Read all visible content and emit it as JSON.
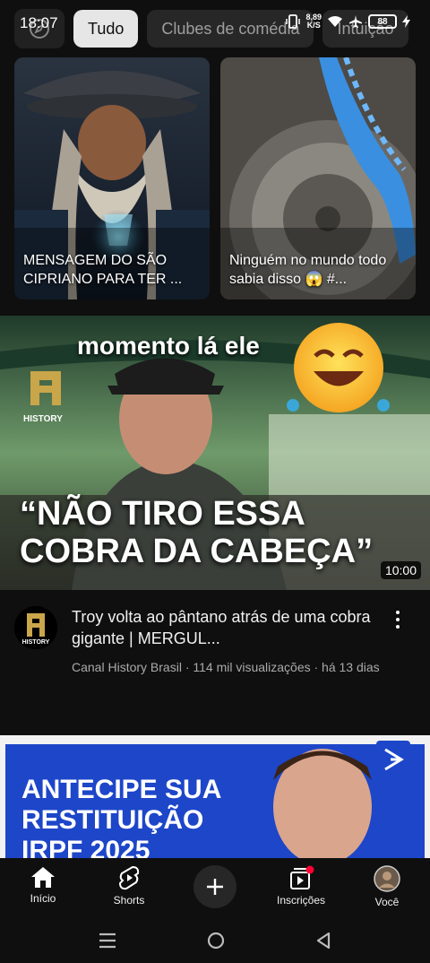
{
  "status": {
    "time": "18:07",
    "net_speed": "8,89",
    "net_unit": "K/S",
    "battery": "88"
  },
  "chips": {
    "items": [
      {
        "label": "Tudo",
        "active": true
      },
      {
        "label": "Clubes de comédia",
        "active": false
      },
      {
        "label": "Intuição",
        "active": false
      }
    ]
  },
  "shorts": [
    {
      "caption": "MENSAGEM DO SÃO CIPRIANO PARA TER ..."
    },
    {
      "caption": "Ninguém no mundo todo sabia disso 😱 #..."
    }
  ],
  "video": {
    "overlay_top": "momento lá ele",
    "overlay_quote_line1": "“NÃO TIRO ESSA",
    "overlay_quote_line2": "COBRA DA CABEÇA”",
    "logo_text": "HISTORY",
    "duration": "10:00",
    "title": "Troy volta ao pântano atrás de uma cobra gigante | MERGUL...",
    "meta": "Canal History Brasil · 114 mil visualizações · há 13 dias",
    "avatar_text": "HISTORY"
  },
  "ad": {
    "line1": "ANTECIPE SUA",
    "line2": "RESTITUIÇÃO",
    "line3": "IRPF 2025"
  },
  "nav": {
    "home": "Início",
    "shorts": "Shorts",
    "subscriptions": "Inscrições",
    "you": "Você"
  },
  "colors": {
    "background": "#0f0f0f",
    "history_gold": "#c9a64a",
    "ad_blue": "#1d46c9",
    "badge_red": "#ff0033"
  }
}
